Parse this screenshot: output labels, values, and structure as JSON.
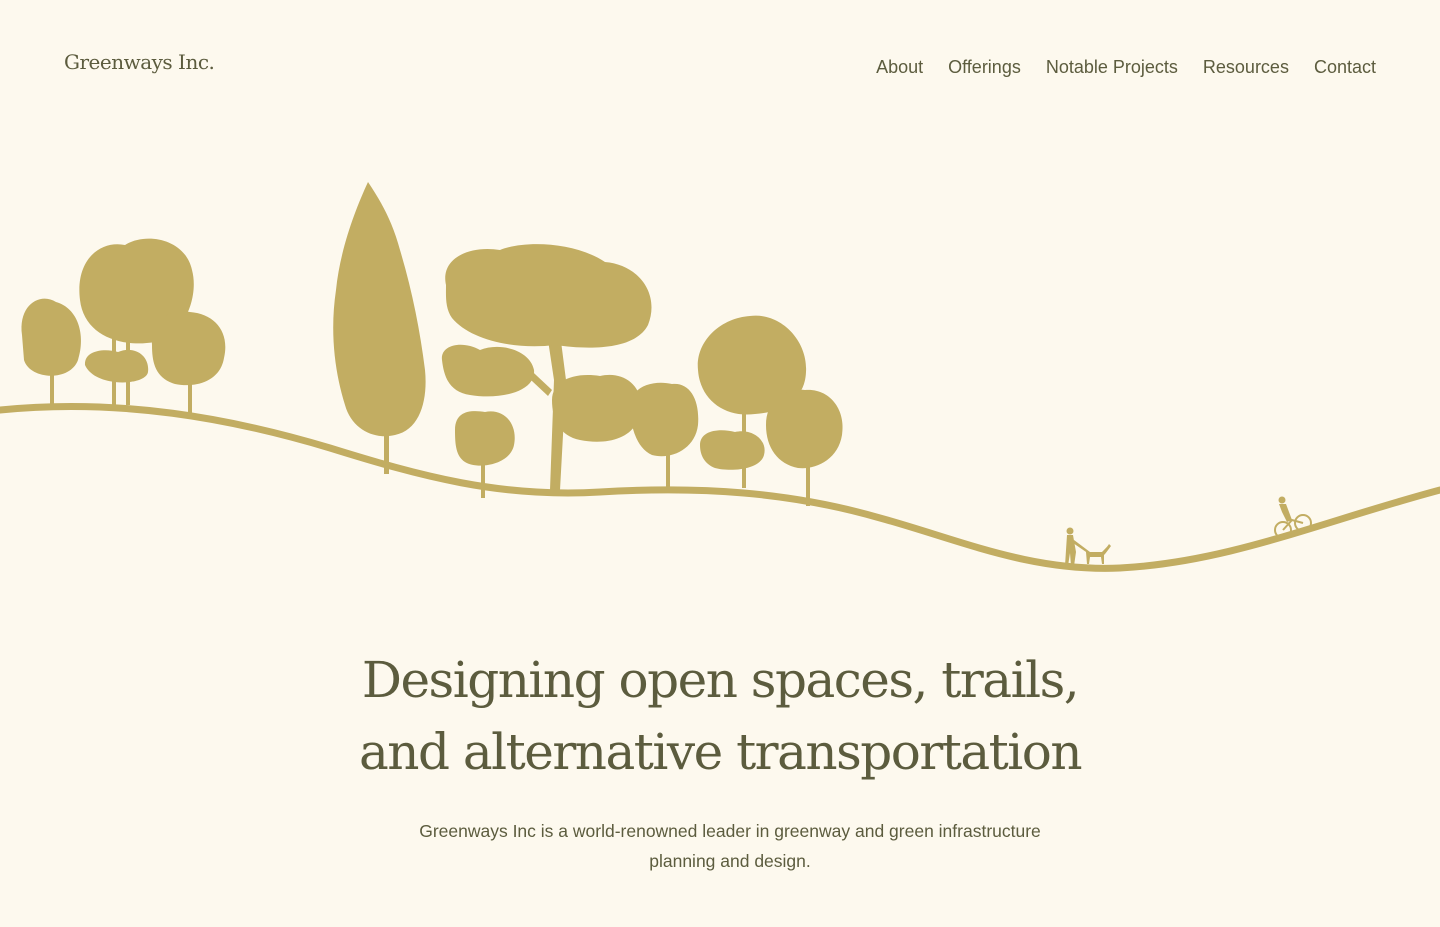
{
  "brand": {
    "name": "Greenways Inc."
  },
  "nav": {
    "items": [
      {
        "label": "About"
      },
      {
        "label": "Offerings"
      },
      {
        "label": "Notable Projects"
      },
      {
        "label": "Resources"
      },
      {
        "label": "Contact"
      }
    ]
  },
  "hero": {
    "headline": "Designing open spaces, trails, and alternative transportation",
    "subtext": "Greenways Inc is a world-renowned leader in greenway and green infrastructure planning and design."
  },
  "colors": {
    "background": "#fdf9ee",
    "text": "#5c5c3e",
    "illustration": "#c2ad62"
  },
  "illustration": {
    "icons": [
      "tree-icon",
      "pedestrian-with-dog-icon",
      "cyclist-icon"
    ]
  }
}
